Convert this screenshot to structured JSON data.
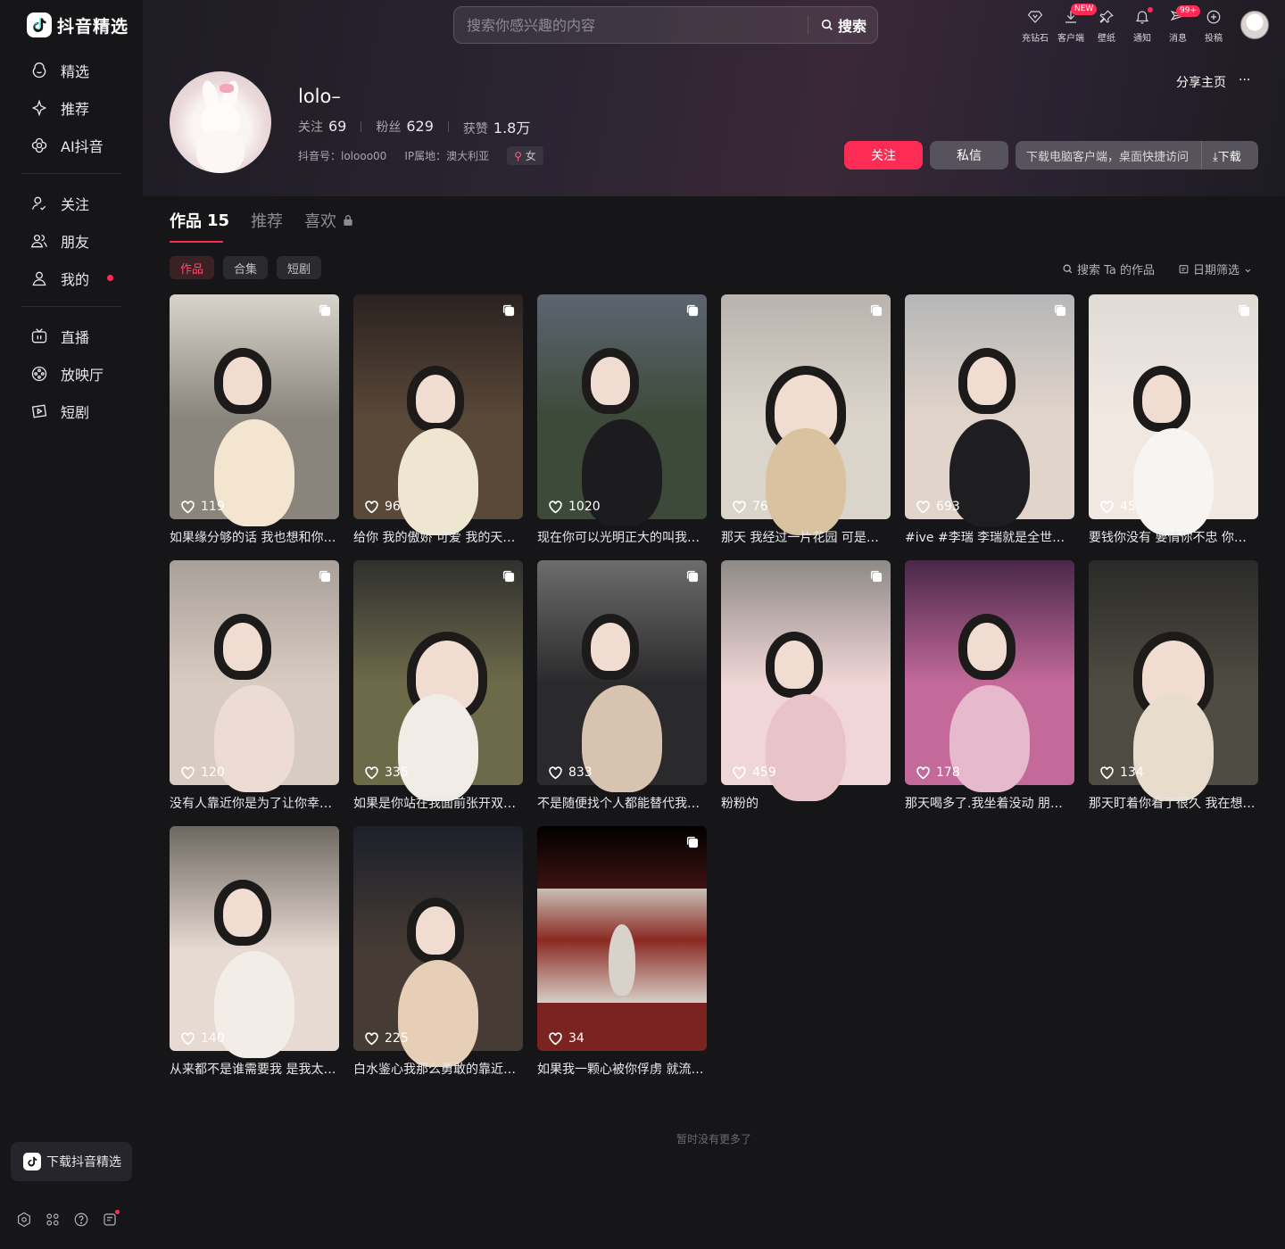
{
  "app": {
    "logo_text": "抖音精选"
  },
  "sidebar": {
    "group1": [
      "精选",
      "推荐",
      "AI抖音"
    ],
    "group2": [
      "关注",
      "朋友",
      "我的"
    ],
    "group3": [
      "直播",
      "放映厅",
      "短剧"
    ],
    "download_label": "下载抖音精选"
  },
  "search": {
    "placeholder": "搜索你感兴趣的内容",
    "button": "搜索"
  },
  "toolbar": {
    "recharge": "充钻石",
    "client": "客户端",
    "client_badge": "NEW",
    "wallpaper": "壁纸",
    "notify": "通知",
    "messages": "消息",
    "messages_badge": "99+",
    "post": "投稿"
  },
  "profile": {
    "name": "lolo–",
    "following_label": "关注",
    "following": "69",
    "fans_label": "粉丝",
    "fans": "629",
    "likes_label": "获赞",
    "likes": "1.8万",
    "douyin_id": "抖音号：lolooo00",
    "ip": "IP属地：澳大利亚",
    "gender": "女",
    "share": "分享主页",
    "more": "···",
    "follow_btn": "关注",
    "message_btn": "私信",
    "download_hint": "下载电脑客户端，桌面快捷访问",
    "download_btn": "下载"
  },
  "tabs": {
    "works_label": "作品",
    "works_count": "15",
    "recommend": "推荐",
    "liked": "喜欢"
  },
  "filters": {
    "chips": [
      "作品",
      "合集",
      "短剧"
    ],
    "search_works": "搜索 Ta 的作品",
    "date_filter": "日期筛选"
  },
  "videos": [
    {
      "likes": "119",
      "desc": "如果缘分够的话 我也想和你…",
      "multi": true,
      "palette": [
        "#d8d4cc",
        "#8a857c",
        "#f3e5d0"
      ]
    },
    {
      "likes": "96",
      "desc": "给你 我的傲娇 可爱 我的天…",
      "multi": true,
      "palette": [
        "#2a2220",
        "#5a4838",
        "#efe6d2"
      ]
    },
    {
      "likes": "1020",
      "desc": "现在你可以光明正大的叫我…",
      "multi": true,
      "palette": [
        "#5d6470",
        "#3d4a3a",
        "#1c1c1e"
      ]
    },
    {
      "likes": "76",
      "desc": "那天 我经过一片花园 可是…",
      "multi": true,
      "palette": [
        "#b8b3ad",
        "#dad4cb",
        "#d9c2a0"
      ]
    },
    {
      "likes": "693",
      "desc": "#ive #李瑞 李瑞就是全世界…",
      "multi": true,
      "palette": [
        "#b5b7b8",
        "#e1d4ca",
        "#1e1e20"
      ]
    },
    {
      "likes": "45",
      "desc": "要钱你没有 要情你不忠 你…",
      "multi": true,
      "palette": [
        "#e0dbd5",
        "#f1e8e2",
        "#f7f5f2"
      ]
    },
    {
      "likes": "120",
      "desc": "没有人靠近你是为了让你幸…",
      "multi": true,
      "palette": [
        "#a8a09a",
        "#d8cbc2",
        "#eddcd4"
      ]
    },
    {
      "likes": "335",
      "desc": "如果是你站在我面前张开双…",
      "multi": true,
      "palette": [
        "#30302f",
        "#6d6a4a",
        "#f1ede6"
      ]
    },
    {
      "likes": "833",
      "desc": "不是随便找个人都能替代我…",
      "multi": true,
      "palette": [
        "#6c6c6c",
        "#2a2a2c",
        "#d8c3b0"
      ]
    },
    {
      "likes": "459",
      "desc": "粉粉的",
      "multi": true,
      "palette": [
        "#8e8a86",
        "#f0d6d6",
        "#e8c4c8"
      ]
    },
    {
      "likes": "178",
      "desc": "那天喝多了.我坐着没动 朋…",
      "multi": false,
      "palette": [
        "#4a2848",
        "#c46a9a",
        "#e7b9cd"
      ]
    },
    {
      "likes": "134",
      "desc": "那天盯着你看了很久 我在想…",
      "multi": false,
      "palette": [
        "#2a2a28",
        "#4e4b42",
        "#e8dccd"
      ]
    },
    {
      "likes": "140",
      "desc": "从来都不是谁需要我 是我太…",
      "multi": false,
      "palette": [
        "#6e6862",
        "#e6dad2",
        "#f3ede8"
      ]
    },
    {
      "likes": "225",
      "desc": "白水鉴心我那么勇敢的靠近…",
      "multi": false,
      "palette": [
        "#1c1f2a",
        "#463c35",
        "#e6cfb6"
      ]
    },
    {
      "likes": "34",
      "desc": "如果我一颗心被你俘虏 就流…",
      "multi": true,
      "palette": [
        "#000000",
        "#7b2320",
        "#d9d2cb"
      ]
    }
  ],
  "footer": {
    "end": "暂时没有更多了"
  }
}
